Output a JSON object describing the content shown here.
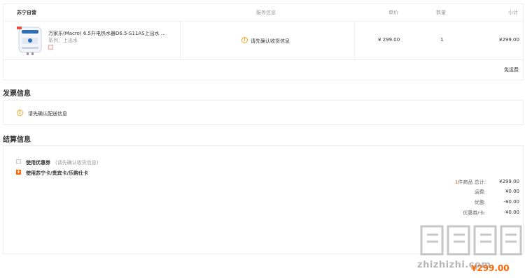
{
  "table_header": {
    "store": "苏宁自营",
    "service": "服务信息",
    "price": "单价",
    "quantity": "数量",
    "subtotal": "小计"
  },
  "product": {
    "name": "万家乐(Macro) 6.5升电热水器D6.5-S11AS上出水 ...",
    "series": "系列：上出水",
    "service_notice": "请先确认收货信息",
    "price": "¥ 299.00",
    "quantity": "1",
    "subtotal": "¥299.00"
  },
  "shipping": "免运费",
  "invoice": {
    "title": "发票信息",
    "notice": "请先确认配送信息"
  },
  "settlement": {
    "title": "结算信息",
    "coupon_label": "使用优惠券",
    "coupon_note": "(请先确认收货信息)",
    "card_label": "使用苏宁卡/贵宾卡/乐购仕卡"
  },
  "summary": {
    "count_number": "1",
    "count_unit": "件商品 总计:",
    "total": "¥299.00",
    "freight_label": "运费:",
    "freight": "¥0.00",
    "discount_label": "优惠:",
    "discount": "-¥0.00",
    "coupon_label": "优惠券/卡:",
    "coupon": "-¥0.00"
  },
  "payable_amount": "¥299.00",
  "watermark": "zhizhizhi.com",
  "colors": {
    "accent": "#ff6600",
    "warning": "#f5a623",
    "border": "#eeeeee"
  }
}
